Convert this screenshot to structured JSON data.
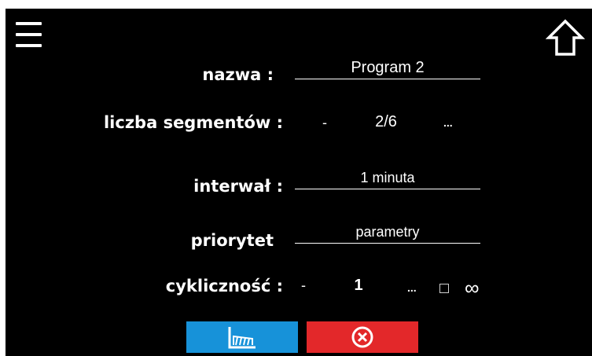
{
  "colors": {
    "background": "#000000",
    "foreground": "#ffffff",
    "chart_button": "#1792d9",
    "cancel_button": "#e3282a"
  },
  "form": {
    "name": {
      "label": "nazwa :",
      "value": "Program 2"
    },
    "segments": {
      "label": "liczba segmentów :",
      "minus": "-",
      "value": "2/6",
      "more": "..."
    },
    "interval": {
      "label": "interwał :",
      "value": "1 minuta"
    },
    "priority": {
      "label": "priorytet",
      "value": "parametry"
    },
    "cyclicity": {
      "label": "cykliczność :",
      "minus": "-",
      "value": "1",
      "more": "...",
      "infinite_symbol": "∞",
      "infinite_checked": false
    }
  },
  "icons": {
    "menu": "hamburger-menu-icon",
    "home": "home-icon",
    "chart": "chart-icon",
    "cancel": "cancel-x-icon"
  }
}
